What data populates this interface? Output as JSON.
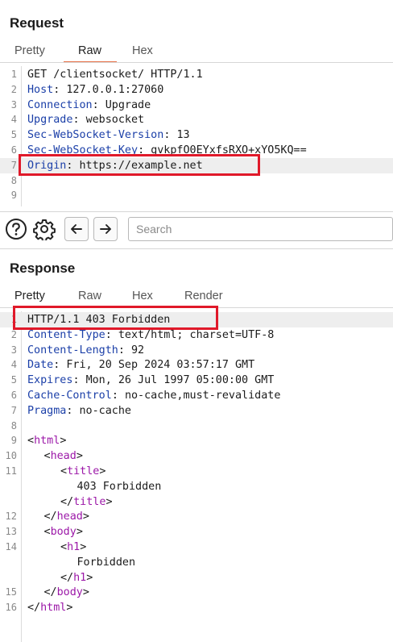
{
  "request": {
    "title": "Request",
    "tabs": [
      "Pretty",
      "Raw",
      "Hex"
    ],
    "active_tab": "Raw",
    "lines": [
      {
        "n": "1",
        "name": "",
        "sep": "",
        "value": "GET /clientsocket/ HTTP/1.1"
      },
      {
        "n": "2",
        "name": "Host",
        "sep": ": ",
        "value": "127.0.0.1:27060"
      },
      {
        "n": "3",
        "name": "Connection",
        "sep": ": ",
        "value": "Upgrade"
      },
      {
        "n": "4",
        "name": "Upgrade",
        "sep": ": ",
        "value": "websocket"
      },
      {
        "n": "5",
        "name": "Sec-WebSocket-Version",
        "sep": ": ",
        "value": "13"
      },
      {
        "n": "6",
        "name": "Sec-WebSocket-Key",
        "sep": ": ",
        "value": "gvkpfO0EYxfsRXO+xYO5KQ=="
      },
      {
        "n": "7",
        "name": "Origin",
        "sep": ": ",
        "value": "https://example.net"
      },
      {
        "n": "8",
        "name": "",
        "sep": "",
        "value": ""
      },
      {
        "n": "9",
        "name": "",
        "sep": "",
        "value": ""
      }
    ]
  },
  "toolbar": {
    "search_placeholder": "Search",
    "icons": [
      "help-icon",
      "gear-icon",
      "arrow-left-icon",
      "arrow-right-icon"
    ]
  },
  "response": {
    "title": "Response",
    "tabs": [
      "Pretty",
      "Raw",
      "Hex",
      "Render"
    ],
    "active_tab": "Pretty",
    "header_lines": [
      {
        "n": "1",
        "name": "",
        "sep": "",
        "value": "HTTP/1.1 403 Forbidden"
      },
      {
        "n": "2",
        "name": "Content-Type",
        "sep": ": ",
        "value": "text/html; charset=UTF-8"
      },
      {
        "n": "3",
        "name": "Content-Length",
        "sep": ": ",
        "value": "92"
      },
      {
        "n": "4",
        "name": "Date",
        "sep": ": ",
        "value": "Fri, 20 Sep 2024 03:57:17 GMT"
      },
      {
        "n": "5",
        "name": "Expires",
        "sep": ": ",
        "value": "Mon, 26 Jul 1997 05:00:00 GMT"
      },
      {
        "n": "6",
        "name": "Cache-Control",
        "sep": ": ",
        "value": "no-cache,must-revalidate"
      },
      {
        "n": "7",
        "name": "Pragma",
        "sep": ": ",
        "value": "no-cache"
      }
    ],
    "body_lines": [
      {
        "n": "8",
        "indent": 0,
        "kind": "blank",
        "text": ""
      },
      {
        "n": "9",
        "indent": 0,
        "kind": "tag",
        "text": "html"
      },
      {
        "n": "10",
        "indent": 1,
        "kind": "tag",
        "text": "head"
      },
      {
        "n": "11",
        "indent": 2,
        "kind": "tag",
        "text": "title"
      },
      {
        "n": "",
        "indent": 3,
        "kind": "text",
        "text": "403 Forbidden"
      },
      {
        "n": "",
        "indent": 2,
        "kind": "close",
        "text": "title"
      },
      {
        "n": "12",
        "indent": 1,
        "kind": "close",
        "text": "head"
      },
      {
        "n": "13",
        "indent": 1,
        "kind": "tag",
        "text": "body"
      },
      {
        "n": "14",
        "indent": 2,
        "kind": "tag",
        "text": "h1"
      },
      {
        "n": "",
        "indent": 3,
        "kind": "text",
        "text": "Forbidden"
      },
      {
        "n": "",
        "indent": 2,
        "kind": "close",
        "text": "h1"
      },
      {
        "n": "15",
        "indent": 1,
        "kind": "close",
        "text": "body"
      },
      {
        "n": "16",
        "indent": 0,
        "kind": "close",
        "text": "html"
      }
    ]
  },
  "colors": {
    "header_name": "#1b3fa8",
    "html_tag": "#9c18a8",
    "highlight_box": "#e0192a",
    "active_tab_underline": "#e8734a"
  }
}
